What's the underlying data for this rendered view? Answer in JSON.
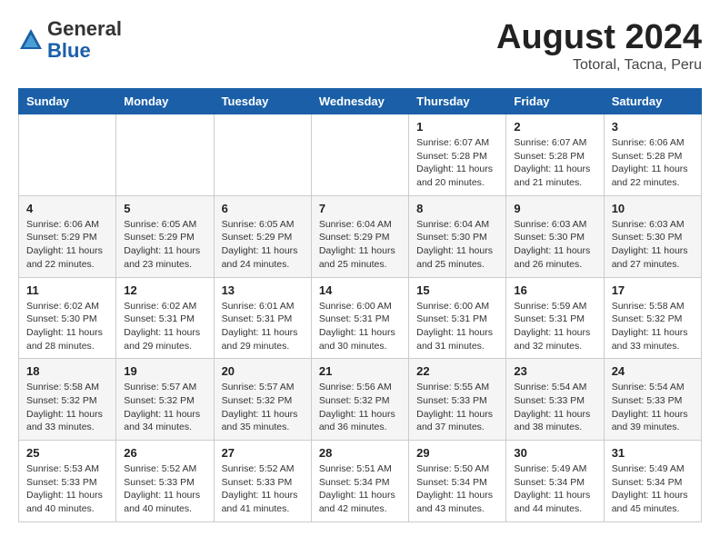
{
  "header": {
    "logo_general": "General",
    "logo_blue": "Blue",
    "title": "August 2024",
    "location": "Totoral, Tacna, Peru"
  },
  "days_of_week": [
    "Sunday",
    "Monday",
    "Tuesday",
    "Wednesday",
    "Thursday",
    "Friday",
    "Saturday"
  ],
  "weeks": [
    [
      {
        "day": "",
        "info": ""
      },
      {
        "day": "",
        "info": ""
      },
      {
        "day": "",
        "info": ""
      },
      {
        "day": "",
        "info": ""
      },
      {
        "day": "1",
        "info": "Sunrise: 6:07 AM\nSunset: 5:28 PM\nDaylight: 11 hours\nand 20 minutes."
      },
      {
        "day": "2",
        "info": "Sunrise: 6:07 AM\nSunset: 5:28 PM\nDaylight: 11 hours\nand 21 minutes."
      },
      {
        "day": "3",
        "info": "Sunrise: 6:06 AM\nSunset: 5:28 PM\nDaylight: 11 hours\nand 22 minutes."
      }
    ],
    [
      {
        "day": "4",
        "info": "Sunrise: 6:06 AM\nSunset: 5:29 PM\nDaylight: 11 hours\nand 22 minutes."
      },
      {
        "day": "5",
        "info": "Sunrise: 6:05 AM\nSunset: 5:29 PM\nDaylight: 11 hours\nand 23 minutes."
      },
      {
        "day": "6",
        "info": "Sunrise: 6:05 AM\nSunset: 5:29 PM\nDaylight: 11 hours\nand 24 minutes."
      },
      {
        "day": "7",
        "info": "Sunrise: 6:04 AM\nSunset: 5:29 PM\nDaylight: 11 hours\nand 25 minutes."
      },
      {
        "day": "8",
        "info": "Sunrise: 6:04 AM\nSunset: 5:30 PM\nDaylight: 11 hours\nand 25 minutes."
      },
      {
        "day": "9",
        "info": "Sunrise: 6:03 AM\nSunset: 5:30 PM\nDaylight: 11 hours\nand 26 minutes."
      },
      {
        "day": "10",
        "info": "Sunrise: 6:03 AM\nSunset: 5:30 PM\nDaylight: 11 hours\nand 27 minutes."
      }
    ],
    [
      {
        "day": "11",
        "info": "Sunrise: 6:02 AM\nSunset: 5:30 PM\nDaylight: 11 hours\nand 28 minutes."
      },
      {
        "day": "12",
        "info": "Sunrise: 6:02 AM\nSunset: 5:31 PM\nDaylight: 11 hours\nand 29 minutes."
      },
      {
        "day": "13",
        "info": "Sunrise: 6:01 AM\nSunset: 5:31 PM\nDaylight: 11 hours\nand 29 minutes."
      },
      {
        "day": "14",
        "info": "Sunrise: 6:00 AM\nSunset: 5:31 PM\nDaylight: 11 hours\nand 30 minutes."
      },
      {
        "day": "15",
        "info": "Sunrise: 6:00 AM\nSunset: 5:31 PM\nDaylight: 11 hours\nand 31 minutes."
      },
      {
        "day": "16",
        "info": "Sunrise: 5:59 AM\nSunset: 5:31 PM\nDaylight: 11 hours\nand 32 minutes."
      },
      {
        "day": "17",
        "info": "Sunrise: 5:58 AM\nSunset: 5:32 PM\nDaylight: 11 hours\nand 33 minutes."
      }
    ],
    [
      {
        "day": "18",
        "info": "Sunrise: 5:58 AM\nSunset: 5:32 PM\nDaylight: 11 hours\nand 33 minutes."
      },
      {
        "day": "19",
        "info": "Sunrise: 5:57 AM\nSunset: 5:32 PM\nDaylight: 11 hours\nand 34 minutes."
      },
      {
        "day": "20",
        "info": "Sunrise: 5:57 AM\nSunset: 5:32 PM\nDaylight: 11 hours\nand 35 minutes."
      },
      {
        "day": "21",
        "info": "Sunrise: 5:56 AM\nSunset: 5:32 PM\nDaylight: 11 hours\nand 36 minutes."
      },
      {
        "day": "22",
        "info": "Sunrise: 5:55 AM\nSunset: 5:33 PM\nDaylight: 11 hours\nand 37 minutes."
      },
      {
        "day": "23",
        "info": "Sunrise: 5:54 AM\nSunset: 5:33 PM\nDaylight: 11 hours\nand 38 minutes."
      },
      {
        "day": "24",
        "info": "Sunrise: 5:54 AM\nSunset: 5:33 PM\nDaylight: 11 hours\nand 39 minutes."
      }
    ],
    [
      {
        "day": "25",
        "info": "Sunrise: 5:53 AM\nSunset: 5:33 PM\nDaylight: 11 hours\nand 40 minutes."
      },
      {
        "day": "26",
        "info": "Sunrise: 5:52 AM\nSunset: 5:33 PM\nDaylight: 11 hours\nand 40 minutes."
      },
      {
        "day": "27",
        "info": "Sunrise: 5:52 AM\nSunset: 5:33 PM\nDaylight: 11 hours\nand 41 minutes."
      },
      {
        "day": "28",
        "info": "Sunrise: 5:51 AM\nSunset: 5:34 PM\nDaylight: 11 hours\nand 42 minutes."
      },
      {
        "day": "29",
        "info": "Sunrise: 5:50 AM\nSunset: 5:34 PM\nDaylight: 11 hours\nand 43 minutes."
      },
      {
        "day": "30",
        "info": "Sunrise: 5:49 AM\nSunset: 5:34 PM\nDaylight: 11 hours\nand 44 minutes."
      },
      {
        "day": "31",
        "info": "Sunrise: 5:49 AM\nSunset: 5:34 PM\nDaylight: 11 hours\nand 45 minutes."
      }
    ]
  ]
}
